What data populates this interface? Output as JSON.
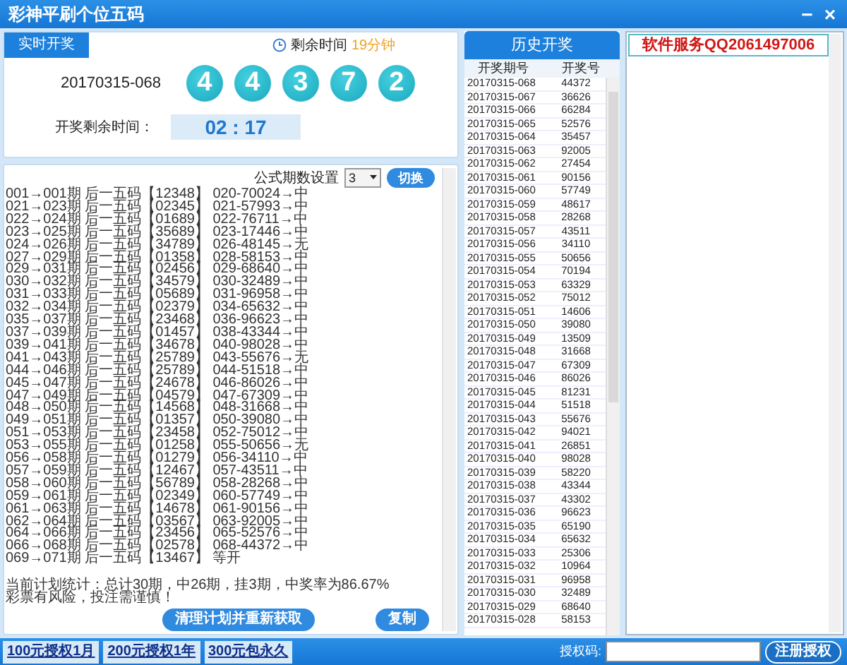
{
  "window": {
    "title": "彩神平刷个位五码",
    "controls": [
      "−",
      "×"
    ]
  },
  "draw_panel": {
    "tab": "实时开奖",
    "remaining_label": "剩余时间",
    "remaining_value": "19分钟",
    "issue": "20170315-068",
    "balls": [
      "4",
      "4",
      "3",
      "7",
      "2"
    ],
    "countdown_label": "开奖剩余时间：",
    "countdown": "02 : 17"
  },
  "plan": {
    "setting_label": "公式期数设置",
    "setting_value": "3",
    "switch_button": "切换",
    "lines": [
      "001→001期 后一五码【12348】 020-70024→中",
      "021→023期 后一五码【02345】 021-57993→中",
      "022→024期 后一五码【01689】 022-76711→中",
      "023→025期 后一五码【35689】 023-17446→中",
      "024→026期 后一五码【34789】 026-48145→无",
      "027→029期 后一五码【01358】 028-58153→中",
      "029→031期 后一五码【02456】 029-68640→中",
      "030→032期 后一五码【34579】 030-32489→中",
      "031→033期 后一五码【05689】 031-96958→中",
      "032→034期 后一五码【02379】 034-65632→中",
      "035→037期 后一五码【23468】 036-96623→中",
      "037→039期 后一五码【01457】 038-43344→中",
      "039→041期 后一五码【34678】 040-98028→中",
      "041→043期 后一五码【25789】 043-55676→无",
      "044→046期 后一五码【25789】 044-51518→中",
      "045→047期 后一五码【24678】 046-86026→中",
      "047→049期 后一五码【04579】 047-67309→中",
      "048→050期 后一五码【14568】 048-31668→中",
      "049→051期 后一五码【01357】 050-39080→中",
      "051→053期 后一五码【23458】 052-75012→中",
      "053→055期 后一五码【01258】 055-50656→无",
      "056→058期 后一五码【01279】 056-34110→中",
      "057→059期 后一五码【12467】 057-43511→中",
      "058→060期 后一五码【56789】 058-28268→中",
      "059→061期 后一五码【02349】 060-57749→中",
      "061→063期 后一五码【14678】 061-90156→中",
      "062→064期 后一五码【03567】 063-92005→中",
      "064→066期 后一五码【23456】 065-52576→中",
      "066→068期 后一五码【02578】 068-44372→中",
      "069→071期 后一五码【13467】 等开"
    ],
    "summary": [
      "当前计划统计：总计30期，中26期，挂3期，中奖率为86.67%",
      "彩票有风险，投注需谨慎！"
    ],
    "buttons": [
      "清理计划并重新获取",
      "复制"
    ]
  },
  "history": {
    "title": "历史开奖",
    "columns": [
      "开奖期号",
      "开奖号"
    ],
    "rows": [
      [
        "20170315-068",
        "44372"
      ],
      [
        "20170315-067",
        "36626"
      ],
      [
        "20170315-066",
        "66284"
      ],
      [
        "20170315-065",
        "52576"
      ],
      [
        "20170315-064",
        "35457"
      ],
      [
        "20170315-063",
        "92005"
      ],
      [
        "20170315-062",
        "27454"
      ],
      [
        "20170315-061",
        "90156"
      ],
      [
        "20170315-060",
        "57749"
      ],
      [
        "20170315-059",
        "48617"
      ],
      [
        "20170315-058",
        "28268"
      ],
      [
        "20170315-057",
        "43511"
      ],
      [
        "20170315-056",
        "34110"
      ],
      [
        "20170315-055",
        "50656"
      ],
      [
        "20170315-054",
        "70194"
      ],
      [
        "20170315-053",
        "63329"
      ],
      [
        "20170315-052",
        "75012"
      ],
      [
        "20170315-051",
        "14606"
      ],
      [
        "20170315-050",
        "39080"
      ],
      [
        "20170315-049",
        "13509"
      ],
      [
        "20170315-048",
        "31668"
      ],
      [
        "20170315-047",
        "67309"
      ],
      [
        "20170315-046",
        "86026"
      ],
      [
        "20170315-045",
        "81231"
      ],
      [
        "20170315-044",
        "51518"
      ],
      [
        "20170315-043",
        "55676"
      ],
      [
        "20170315-042",
        "94021"
      ],
      [
        "20170315-041",
        "26851"
      ],
      [
        "20170315-040",
        "98028"
      ],
      [
        "20170315-039",
        "58220"
      ],
      [
        "20170315-038",
        "43344"
      ],
      [
        "20170315-037",
        "43302"
      ],
      [
        "20170315-036",
        "96623"
      ],
      [
        "20170315-035",
        "65190"
      ],
      [
        "20170315-034",
        "65632"
      ],
      [
        "20170315-033",
        "25306"
      ],
      [
        "20170315-032",
        "10964"
      ],
      [
        "20170315-031",
        "96958"
      ],
      [
        "20170315-030",
        "32489"
      ],
      [
        "20170315-029",
        "68640"
      ],
      [
        "20170315-028",
        "58153"
      ]
    ]
  },
  "service": {
    "items": [
      {
        "label": "软件服务QQ2061497006",
        "selected": true
      }
    ]
  },
  "footer": {
    "links": [
      "100元授权1月",
      "200元授权1年",
      "300元包永久"
    ],
    "code_label": "授权码:",
    "register_button": "注册授权"
  }
}
